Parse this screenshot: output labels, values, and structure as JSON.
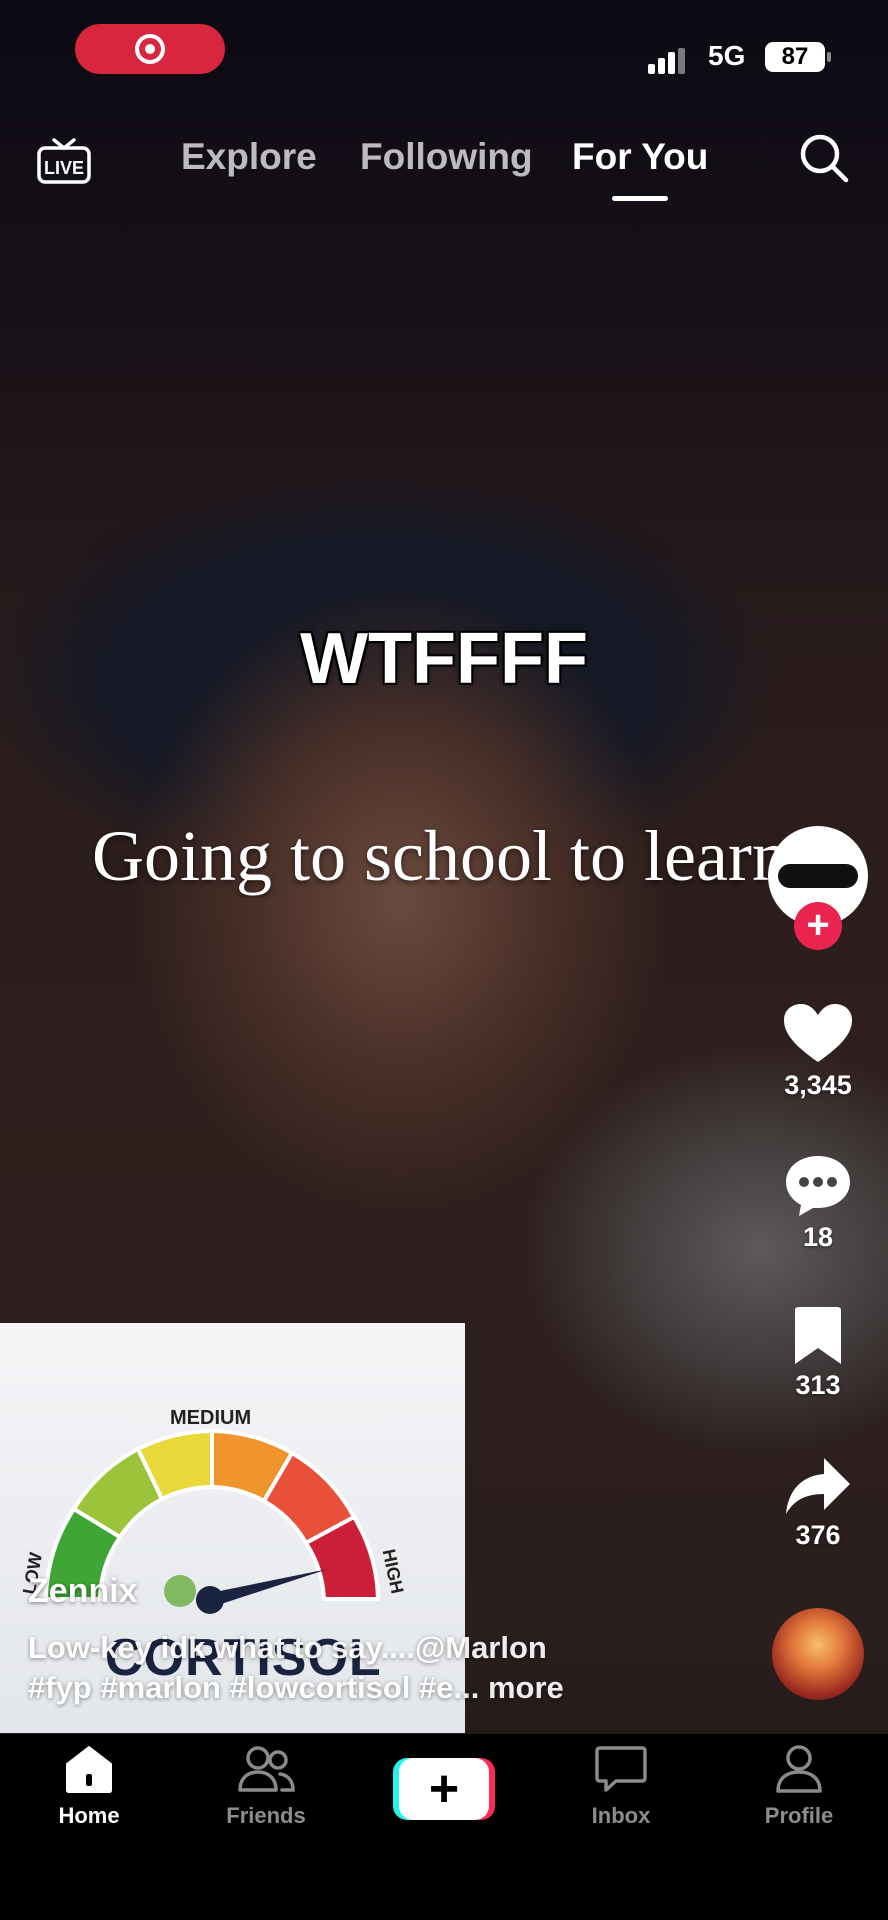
{
  "status_bar": {
    "network": "5G",
    "battery": "87"
  },
  "top_nav": {
    "live_label": "LIVE",
    "tabs": [
      {
        "label": "Explore",
        "active": false
      },
      {
        "label": "Following",
        "active": false
      },
      {
        "label": "For You",
        "active": true
      }
    ]
  },
  "video": {
    "overlay_title": "WTFFFF",
    "overlay_subtitle": "Going to school to learn"
  },
  "actions": {
    "likes": "3,345",
    "comments": "18",
    "bookmarks": "313",
    "shares": "376"
  },
  "inset_image": {
    "gauge_medium": "MEDIUM",
    "gauge_low": "LOW",
    "gauge_high": "HIGH",
    "gauge_title": "CORTISOL"
  },
  "caption": {
    "username": "Zennix",
    "line1": "Low-key idk what to say....@Marlon",
    "line2": "#fyp #marlon #lowcortisol #e... more"
  },
  "bottom_nav": {
    "items": [
      {
        "label": "Home",
        "active": true
      },
      {
        "label": "Friends",
        "active": false
      },
      {
        "label": "Inbox",
        "active": false
      },
      {
        "label": "Profile",
        "active": false
      }
    ],
    "create_symbol": "+"
  },
  "colors": {
    "accent": "#fe2c55",
    "secondary_accent": "#25f4ee",
    "recording_pill": "#d7263d"
  }
}
